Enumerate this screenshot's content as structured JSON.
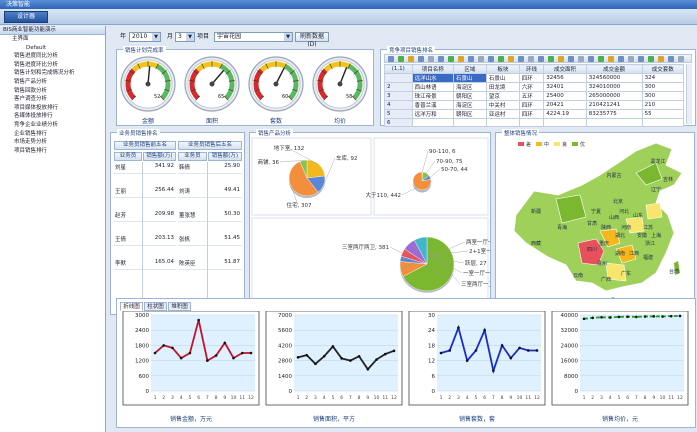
{
  "window": {
    "title": "决策智能"
  },
  "toolbar": {
    "designer_label": "设计器"
  },
  "sidebar": {
    "header": "BIS商业智能功能演示",
    "root": "主界面",
    "sub": "Default",
    "items": [
      "销售进度同比分析",
      "销售进度环比分析",
      "销售计划和完成情况分析",
      "销售产品分析",
      "销售回款分析",
      "客户调查分析",
      "项目媒体投放排行",
      "各媒体投放排行",
      "竞争企业业绩分析",
      "企业销售排行",
      "市场走势分析",
      "项目销售排行"
    ]
  },
  "filters": {
    "year_label": "年",
    "year_value": "2010",
    "month_label": "月",
    "month_value": "3",
    "project_label": "项目",
    "project_value": "宇宙花园",
    "refresh_label": "刷新数据(D)"
  },
  "gauges": {
    "title": "销售计划完成率",
    "labels": [
      "金额",
      "面积",
      "套数",
      "均价"
    ],
    "values": [
      52,
      65,
      60,
      58
    ]
  },
  "competitors": {
    "title": "竞争项目销售排名",
    "columns": [
      "(1,1)",
      "项目名称",
      "区域",
      "板块",
      "环线",
      "成交面积",
      "成交金额",
      "成交套数"
    ],
    "rows": [
      [
        "1",
        "远洋山水",
        "石景山",
        "石景山",
        "四环",
        "32456",
        "324560000",
        "324"
      ],
      [
        "2",
        "西山林语",
        "海淀区",
        "田龙境",
        "六环",
        "32401",
        "324010000",
        "300"
      ],
      [
        "3",
        "珠江帝景",
        "朝阳区",
        "望京",
        "五环",
        "25400",
        "265000000",
        "300"
      ],
      [
        "4",
        "香普兰溪",
        "海淀区",
        "中关村",
        "四环",
        "20421",
        "210421241",
        "210"
      ],
      [
        "5",
        "远洋万和",
        "朝阳区",
        "亚运村",
        "四环",
        "4224.19",
        "83235775",
        "55"
      ],
      [
        "6",
        "",
        "",
        "",
        "",
        "",
        "",
        ""
      ]
    ]
  },
  "staff": {
    "title": "业务员销售排名",
    "top_label": "业务员销售前五名",
    "bottom_label": "业务员销售后五名",
    "col_name": "业务员",
    "col_amount": "销售额(万)",
    "top": [
      [
        "刘星",
        "341.92"
      ],
      [
        "王丽",
        "256.44"
      ],
      [
        "赵芳",
        "209.98"
      ],
      [
        "王倩",
        "203.13"
      ],
      [
        "李默",
        "165.04"
      ]
    ],
    "bottom": [
      [
        "韩倩",
        "25.90"
      ],
      [
        "刘涛",
        "49.41"
      ],
      [
        "董张慧",
        "50.30"
      ],
      [
        "张帆",
        "51.45"
      ],
      [
        "陈英臣",
        "51.87"
      ]
    ]
  },
  "products": {
    "title": "销售产品分析",
    "pie1": [
      {
        "name": "地下室",
        "value": 132,
        "color": "#f5b81c"
      },
      {
        "name": "车库",
        "value": 92,
        "color": "#5a86d8"
      },
      {
        "name": "住宅",
        "value": 307,
        "color": "#f28e3c"
      },
      {
        "name": "商铺",
        "value": 36,
        "color": "#8bc34a"
      }
    ],
    "pie2": [
      {
        "name": "90-110",
        "value": 6,
        "color": "#f5b81c"
      },
      {
        "name": "70-90",
        "value": 75,
        "color": "#8bc34a"
      },
      {
        "name": "50-70",
        "value": 44,
        "color": "#5a86d8"
      },
      {
        "name": "大于110",
        "value": 442,
        "color": "#f28e3c"
      }
    ],
    "pie3": [
      {
        "name": "三室两厅两卫",
        "value": 381,
        "color": "#7cb82f"
      },
      {
        "name": "两室一厅一卫",
        "value": 52,
        "color": "#f28e3c"
      },
      {
        "name": "2+1室一厅两卫",
        "value": 18,
        "color": "#5a86d8"
      },
      {
        "name": "跃层",
        "value": 27,
        "color": "#e8505b"
      },
      {
        "name": "一室一厅一卫",
        "value": 44,
        "color": "#9c6ad3"
      },
      {
        "name": "三室两厅一卫",
        "value": 44,
        "color": "#3fb8c9"
      }
    ]
  },
  "map": {
    "title": "整体销售情况",
    "legend": [
      {
        "label": "差",
        "color": "#e8505b"
      },
      {
        "label": "中",
        "color": "#f5b81c"
      },
      {
        "label": "良",
        "color": "#f7e66b"
      },
      {
        "label": "优",
        "color": "#7cb82f"
      }
    ],
    "regions": [
      "新疆",
      "西藏",
      "青海",
      "内蒙古",
      "黑龙江",
      "吉林",
      "辽宁",
      "北京",
      "宁夏",
      "山西",
      "河北",
      "山东",
      "甘肃",
      "陕西",
      "河南",
      "江苏",
      "四川",
      "湖北",
      "安徽",
      "上海",
      "重庆",
      "湖南",
      "江西",
      "浙江",
      "贵州",
      "福建",
      "云南",
      "广西",
      "广东",
      "台湾",
      "海南"
    ]
  },
  "bottom_tabs": [
    "折线图",
    "柱状图",
    "堆积图"
  ],
  "charts": [
    {
      "caption": "销售金额，万元",
      "yticks": [
        "3000",
        "2400",
        "1800",
        "1200",
        "600",
        "0"
      ],
      "color": "#c0142a"
    },
    {
      "caption": "销售面积，平方",
      "yticks": [
        "7000",
        "5600",
        "4200",
        "2800",
        "1400",
        "0"
      ],
      "color": "#222222"
    },
    {
      "caption": "销售套数，套",
      "yticks": [
        "30",
        "24",
        "18",
        "12",
        "6",
        "0"
      ],
      "color": "#1b2dc9"
    },
    {
      "caption": "销售均价，元",
      "yticks": [
        "40000",
        "32000",
        "24000",
        "16000",
        "8000",
        "0"
      ],
      "color": "#1aa02a"
    }
  ],
  "chart_data": [
    {
      "type": "line",
      "title": "",
      "xlabel": "销售金额，万元",
      "categories": [
        "1",
        "2",
        "3",
        "4",
        "5",
        "6",
        "7",
        "8",
        "9",
        "10",
        "11",
        "12"
      ],
      "series": [
        {
          "values": [
            1500,
            1800,
            1700,
            1300,
            1500,
            2800,
            1200,
            1400,
            1900,
            1300,
            1500,
            1500
          ]
        }
      ],
      "ylim": [
        0,
        3000
      ]
    },
    {
      "type": "line",
      "title": "",
      "xlabel": "销售面积，平方",
      "categories": [
        "1",
        "2",
        "3",
        "4",
        "5",
        "6",
        "7",
        "8",
        "9",
        "10",
        "11",
        "12"
      ],
      "series": [
        {
          "values": [
            3100,
            3300,
            2500,
            3200,
            4100,
            3000,
            2800,
            3200,
            2000,
            2900,
            3400,
            3700
          ]
        }
      ],
      "ylim": [
        0,
        7000
      ]
    },
    {
      "type": "line",
      "title": "",
      "xlabel": "销售套数，套",
      "categories": [
        "1",
        "2",
        "3",
        "4",
        "5",
        "6",
        "7",
        "8",
        "9",
        "10",
        "11",
        "12"
      ],
      "series": [
        {
          "values": [
            15,
            16,
            25,
            12,
            16,
            24,
            8,
            18,
            13,
            17,
            16,
            16
          ]
        }
      ],
      "ylim": [
        0,
        30
      ]
    },
    {
      "type": "line",
      "title": "",
      "xlabel": "销售均价，元",
      "categories": [
        "1",
        "2",
        "3",
        "4",
        "5",
        "6",
        "7",
        "8",
        "9",
        "10",
        "11",
        "12"
      ],
      "series": [
        {
          "values": [
            38000,
            38500,
            38800,
            38700,
            39000,
            39100,
            39000,
            39200,
            39300,
            39200,
            39400,
            39500
          ]
        }
      ],
      "ylim": [
        0,
        40000
      ]
    }
  ]
}
